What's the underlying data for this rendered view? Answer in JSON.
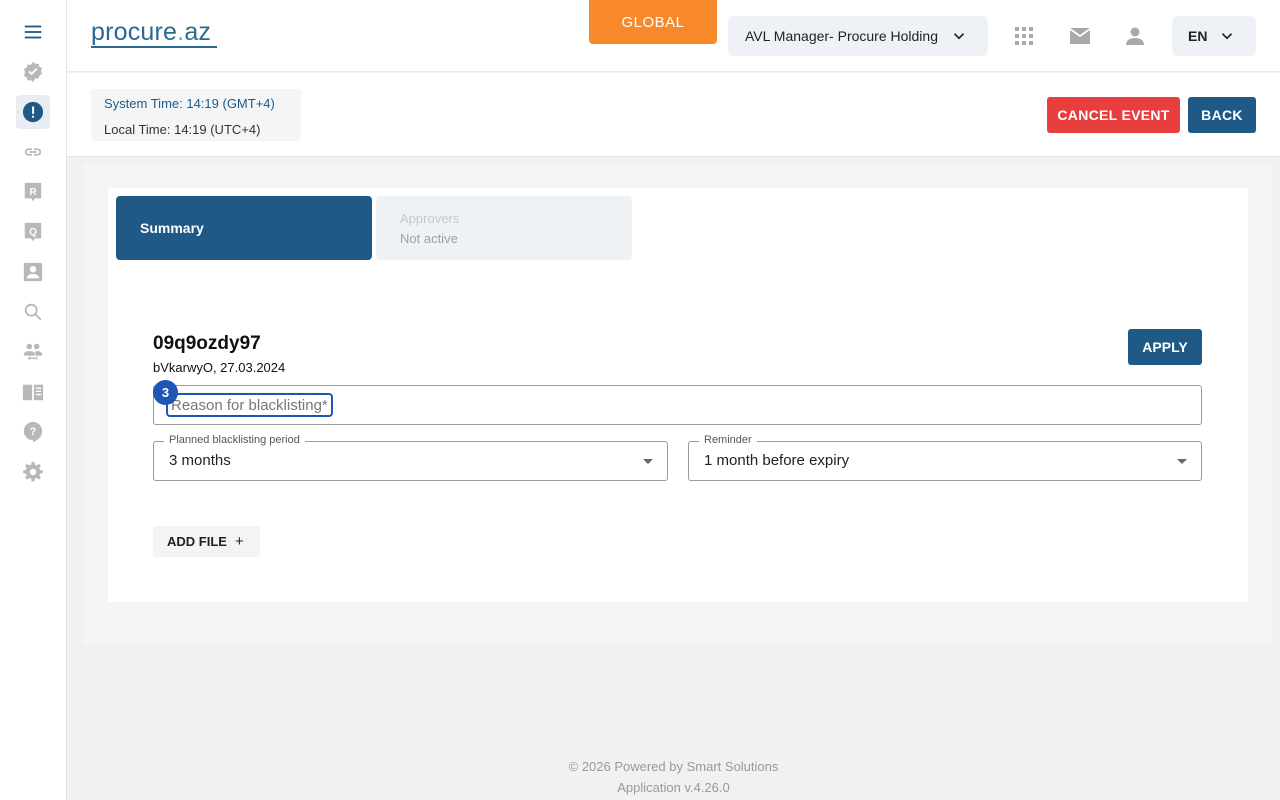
{
  "logo": {
    "text_main": "procure",
    "text_dot": ".",
    "text_end": "az"
  },
  "header": {
    "global_label": "GLOBAL",
    "org_select": "AVL Manager- Procure Holding",
    "language": "EN"
  },
  "sidebar": {
    "icons": [
      "menu-icon",
      "verified-icon",
      "alert-icon",
      "link-icon",
      "r-badge-icon",
      "q-badge-icon",
      "contact-icon",
      "search-icon",
      "people-icon",
      "book-icon",
      "help-icon",
      "settings-icon"
    ]
  },
  "subheader": {
    "system_time": "System Time: 14:19 (GMT+4)",
    "local_time": "Local Time: 14:19 (UTC+4)",
    "cancel_label": "CANCEL EVENT",
    "back_label": "BACK"
  },
  "tabs": {
    "summary": "Summary",
    "approvers_title": "Approvers",
    "approvers_status": "Not active"
  },
  "item": {
    "title": "09q9ozdy97",
    "subtitle": "bVkarwyO, 27.03.2024",
    "apply_label": "APPLY"
  },
  "form": {
    "badge": "3",
    "reason_placeholder": "Reason for blacklisting*",
    "period_label": "Planned blacklisting period",
    "period_value": "3 months",
    "reminder_label": "Reminder",
    "reminder_value": "1 month before expiry",
    "add_file_label": "ADD FILE",
    "add_file_plus": "+"
  },
  "footer": {
    "line1": "© 2026 Powered by Smart Solutions",
    "line2": "Application v.4.26.0"
  },
  "colors": {
    "primary": "#1f5a86",
    "accent_orange": "#f7892b",
    "danger": "#e83e3e",
    "focus_blue": "#1e56b4"
  }
}
